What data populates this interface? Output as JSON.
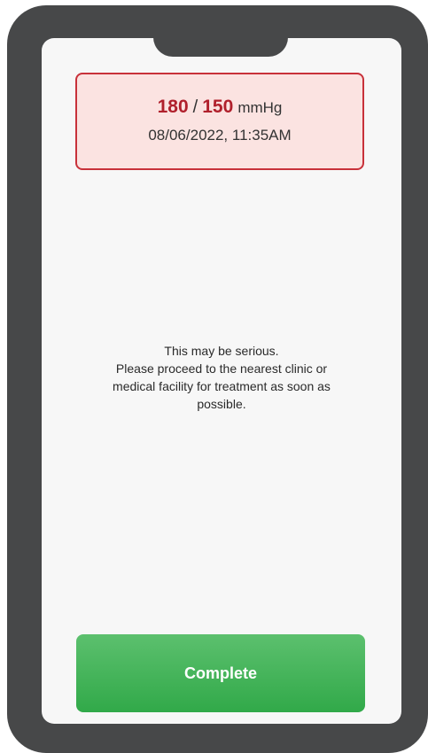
{
  "reading": {
    "systolic": "180",
    "separator": "/",
    "diastolic": "150",
    "unit": "mmHg",
    "timestamp": "08/06/2022, 11:35AM"
  },
  "message": {
    "lines": [
      "This may be serious.",
      "Please proceed to the nearest clinic or",
      "medical facility for treatment as soon as",
      "possible."
    ]
  },
  "actions": {
    "complete_label": "Complete"
  },
  "colors": {
    "alert_border": "#c8313a",
    "alert_background": "#fbe3e1",
    "alert_value": "#b0202c",
    "button_green": "#31a949",
    "device_frame": "#474849"
  }
}
